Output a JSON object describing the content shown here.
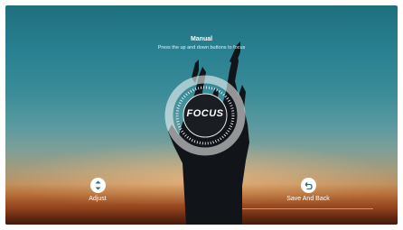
{
  "header": {
    "title": "Manual",
    "instruction": "Press the up and down buttons to focus"
  },
  "focus": {
    "label": "FOCUS"
  },
  "controls": {
    "adjust_label": "Adjust",
    "save_back_label": "Save And Back",
    "adjust_icon": "up-down-arrows-icon",
    "save_back_icon": "return-arrow-icon"
  },
  "colors": {
    "sky_top": "#1f6f7e",
    "sunset": "#d08a4a",
    "ring": "#ffffff"
  }
}
